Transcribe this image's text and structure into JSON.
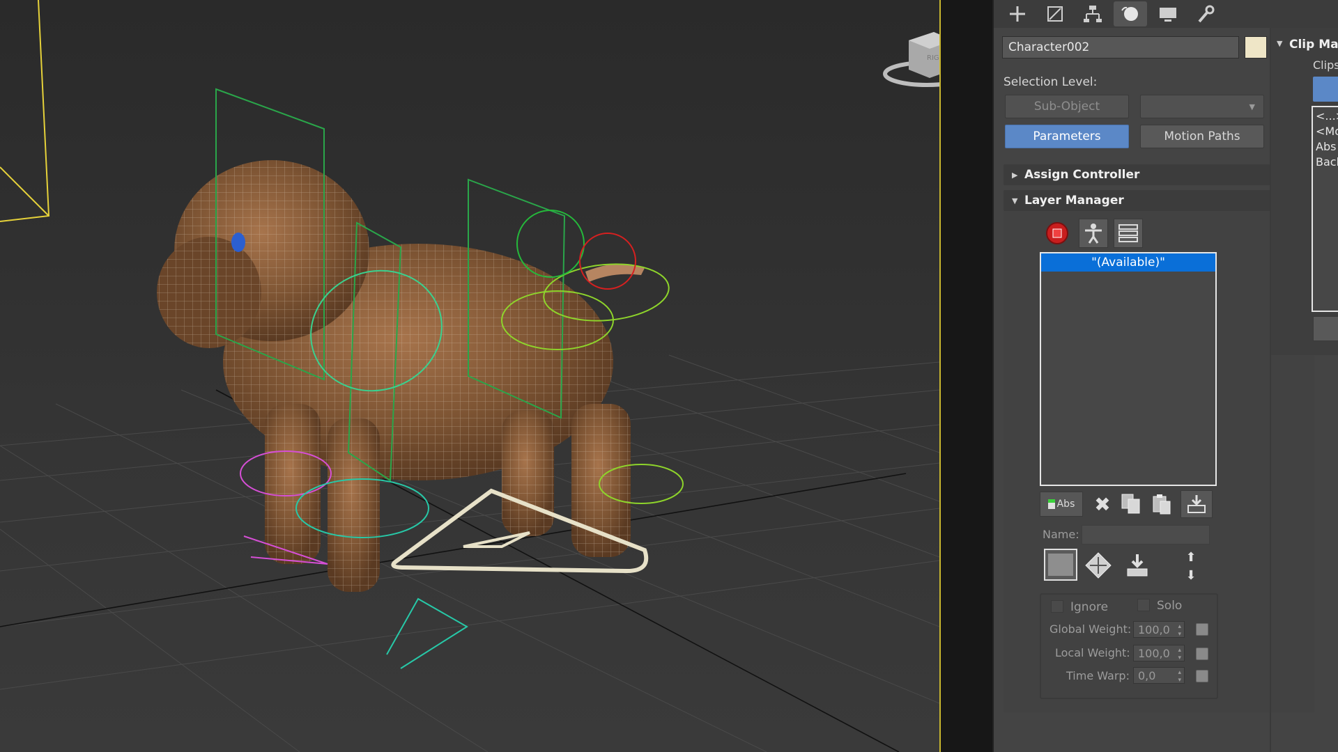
{
  "viewport": {
    "navcube_label": "RIGHT"
  },
  "command_panel": {
    "tabs": [
      {
        "icon": "create-icon",
        "active": false
      },
      {
        "icon": "modify-icon",
        "active": false
      },
      {
        "icon": "hierarchy-icon",
        "active": false
      },
      {
        "icon": "motion-icon",
        "active": true
      },
      {
        "icon": "display-icon",
        "active": false
      },
      {
        "icon": "utilities-icon",
        "active": false
      }
    ],
    "object_name": "Character002",
    "object_color": "#efe6c7",
    "selection_level_label": "Selection Level:",
    "sub_object_label": "Sub-Object",
    "sub_object_dropdown_value": "",
    "parameters_label": "Parameters",
    "motion_paths_label": "Motion Paths",
    "rollouts": {
      "assign_controller": "Assign Controller",
      "layer_manager": "Layer Manager"
    },
    "layer_list": {
      "items": [
        "\"(Available)\""
      ]
    },
    "abs_label": "Abs",
    "name_label": "Name:",
    "name_value": "",
    "ignore_label": "Ignore",
    "solo_label": "Solo",
    "global_weight_label": "Global Weight:",
    "global_weight_value": "100,0",
    "local_weight_label": "Local Weight:",
    "local_weight_value": "100,0",
    "time_warp_label": "Time Warp:",
    "time_warp_value": "0,0"
  },
  "clip_panel": {
    "title": "Clip Ma",
    "clips_label": "Clips",
    "list_lines": [
      "<...>",
      "<Mo",
      "Abs",
      "Back"
    ]
  },
  "colors": {
    "accent_blue": "#5b88c7",
    "selection_blue": "#0a6fd8",
    "viewport_border": "#c9b72f"
  }
}
